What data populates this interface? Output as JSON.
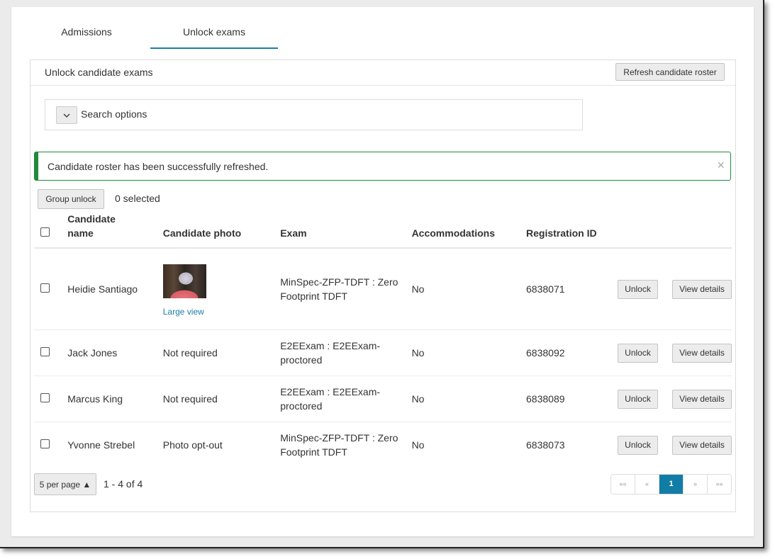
{
  "tabs": [
    {
      "label": "Admissions",
      "active": false
    },
    {
      "label": "Unlock exams",
      "active": true
    }
  ],
  "panel": {
    "title": "Unlock candidate exams",
    "refresh_label": "Refresh candidate roster"
  },
  "search": {
    "label": "Search options",
    "toggle_icon": "chevron-down-icon"
  },
  "alert": {
    "message": "Candidate roster has been successfully refreshed.",
    "close_icon": "close-icon",
    "color": "#1e8a3a"
  },
  "toolbar": {
    "group_unlock_label": "Group unlock",
    "selected_text": "0 selected"
  },
  "table": {
    "headers": [
      "Candidate name",
      "Candidate photo",
      "Exam",
      "Accommodations",
      "Registration ID"
    ],
    "rows": [
      {
        "name": "Heidie Santiago",
        "photo": "",
        "photo_link": "Large view",
        "exam": "MinSpec-ZFP-TDFT : Zero Footprint TDFT",
        "accommodations": "No",
        "registration_id": "6838071",
        "unlock": "Unlock",
        "details": "View details"
      },
      {
        "name": "Jack Jones",
        "photo": "Not required",
        "exam": "E2EExam : E2EExam-proctored",
        "accommodations": "No",
        "registration_id": "6838092",
        "unlock": "Unlock",
        "details": "View details"
      },
      {
        "name": "Marcus King",
        "photo": "Not required",
        "exam": "E2EExam : E2EExam-proctored",
        "accommodations": "No",
        "registration_id": "6838089",
        "unlock": "Unlock",
        "details": "View details"
      },
      {
        "name": "Yvonne Strebel",
        "photo": "Photo opt-out",
        "exam": "MinSpec-ZFP-TDFT : Zero Footprint TDFT",
        "accommodations": "No",
        "registration_id": "6838073",
        "unlock": "Unlock",
        "details": "View details"
      }
    ]
  },
  "pagination": {
    "per_page_label": "5 per page ▲",
    "range_text": "1 - 4 of 4",
    "first": "««",
    "prev": "«",
    "current": "1",
    "next": "»",
    "last": "»»",
    "accent": "#117da6"
  }
}
